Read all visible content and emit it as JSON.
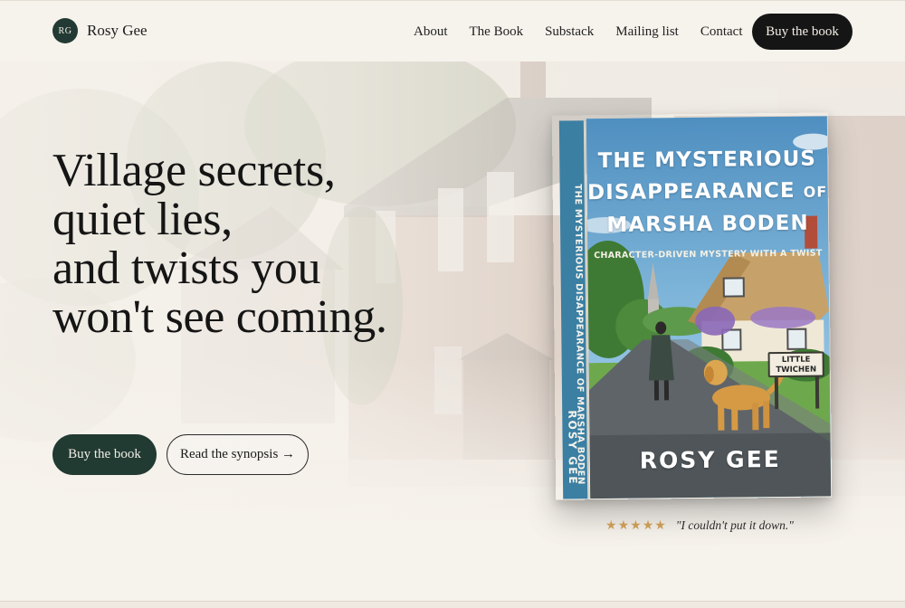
{
  "brand": {
    "initials": "RG",
    "name": "Rosy Gee"
  },
  "nav": {
    "items": [
      "About",
      "The Book",
      "Substack",
      "Mailing list",
      "Contact"
    ],
    "cta": "Buy the book"
  },
  "hero": {
    "headline": [
      "Village secrets,",
      "quiet lies,",
      "and twists you",
      "won't see coming."
    ],
    "primary_button": "Buy the book",
    "secondary_button": "Read the synopsis →"
  },
  "book": {
    "spine_title": "THE MYSTERIOUS DISAPPEARANCE OF MARSHA BODEN",
    "spine_author": "ROSY GEE",
    "title_lines": [
      "THE MYSTERIOUS",
      "DISAPPEARANCE",
      "MARSHA BODEN"
    ],
    "title_of": "OF",
    "subtitle": "CHARACTER-DRIVEN MYSTERY WITH A TWIST",
    "sign_lines": [
      "LITTLE",
      "TWICHEN"
    ],
    "author": "ROSY GEE"
  },
  "review": {
    "stars": 5,
    "star_glyph": "★",
    "quote": "\"I couldn't put it down.\""
  },
  "colors": {
    "background": "#f6f2ec",
    "accent_green": "#213a32",
    "dark_button": "#151515",
    "spine_blue": "#3b7fa3",
    "star_gold": "#c99a53"
  }
}
